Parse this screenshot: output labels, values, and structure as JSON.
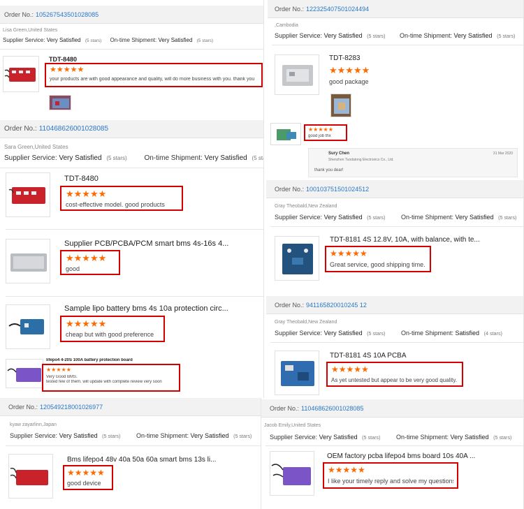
{
  "stars": "★★★★★",
  "p1": {
    "order_label": "Order No.:",
    "order_no": "105267543501028085",
    "buyer": "Lisa Green,United States",
    "supplier_label": "Supplier Service:",
    "supplier_value": "Very Satisfied",
    "supplier_stars": "(5 stars)",
    "ontime_label": "On-time Shipment:",
    "ontime_value": "Very Satisfied",
    "ontime_stars": "(5 stars)",
    "product": "TDT-8480",
    "review": "your products are with good appearance and quality, will do more business with you. thank you"
  },
  "p2": {
    "order_label": "Order No.:",
    "order_no": "110468626001028085",
    "buyer": "Sara Green,United States",
    "supplier_label": "Supplier Service:",
    "supplier_value": "Very Satisfied",
    "supplier_stars": "(5 stars)",
    "ontime_label": "On-time Shipment:",
    "ontime_value": "Very Satisfied",
    "ontime_stars": "(5 stars)",
    "items": [
      {
        "product": "TDT-8480",
        "review": "cost-effective model. good products"
      },
      {
        "product": "Supplier PCB/PCBA/PCM smart bms 4s-16s 4...",
        "review": "good"
      },
      {
        "product": "Sample lipo battery bms 4s 10a protection circ...",
        "review": "cheap but with good preference"
      }
    ],
    "extra_product": "lifepo4 4-20S 100A battery protection board",
    "extra_review_1": "Very Good BMS.",
    "extra_review_2": "tested few of them. will update with complete review very soon"
  },
  "p3": {
    "order_label": "Order No.:",
    "order_no": "120549218001026977",
    "buyer": "kyaw zayarlinn,Japan",
    "supplier_label": "Supplier Service:",
    "supplier_value": "Very Satisfied",
    "supplier_stars": "(5 stars)",
    "ontime_label": "On-time Shipment:",
    "ontime_value": "Very Satisfied",
    "ontime_stars": "(5 stars)",
    "product": "Bms lifepo4 48v 40a 50a 60a smart bms 13s li...",
    "review": "good device"
  },
  "p4": {
    "order_label": "Order No.:",
    "order_no": "122325407501024494",
    "buyer": ",Cambodia",
    "supplier_label": "Supplier Service:",
    "supplier_value": "Very Satisfied",
    "supplier_stars": "(5 stars)",
    "ontime_label": "On-time Shipment:",
    "ontime_value": "Very Satisfied",
    "ontime_stars": "(5 stars)",
    "product": "TDT-8283",
    "review": "good package",
    "extra_review": "good job thx",
    "reply_name": "Sury Chen",
    "reply_company": "Shenzhen Tuodatong Electronics Co., Ltd.",
    "reply_date": "31 Mar 2020",
    "reply_text": "thank you dear!"
  },
  "p5": {
    "order_label": "Order No.:",
    "order_no": "100103751501024512",
    "buyer": "Gray Theobald,New Zealand",
    "supplier_label": "Supplier Service:",
    "supplier_value": "Very Satisfied",
    "supplier_stars": "(5 stars)",
    "ontime_label": "On-time Shipment:",
    "ontime_value": "Very Satisfied",
    "ontime_stars": "(5 stars)",
    "product": "TDT-8181 4S 12.8V, 10A, with balance, with te...",
    "review": "Great service, good shipping time."
  },
  "p6": {
    "order_label": "Order No.:",
    "order_no": "941165820010245 12",
    "buyer": "Gray Theobald,New Zealand",
    "supplier_label": "Supplier Service:",
    "supplier_value": "Very Satisfied",
    "supplier_stars": "(5 stars)",
    "ontime_label": "On-time Shipment:",
    "ontime_value": "Satisfied",
    "ontime_stars": "(4 stars)",
    "product": "TDT-8181 4S 10A PCBA",
    "review": "As yet untested but appear to be very good quality."
  },
  "p7": {
    "order_label": "Order No.:",
    "order_no": "110468626001028085",
    "buyer": "Jacob Emily,United States",
    "supplier_label": "Supplier Service:",
    "supplier_value": "Very Satisfied",
    "supplier_stars": "(5 stars)",
    "ontime_label": "On-time Shipment:",
    "ontime_value": "Very Satisfied",
    "ontime_stars": "(5 stars)",
    "product": "OEM factory pcba lifepo4 bms board 10s 40A ...",
    "review": "I like your timely reply and solve my questions"
  }
}
